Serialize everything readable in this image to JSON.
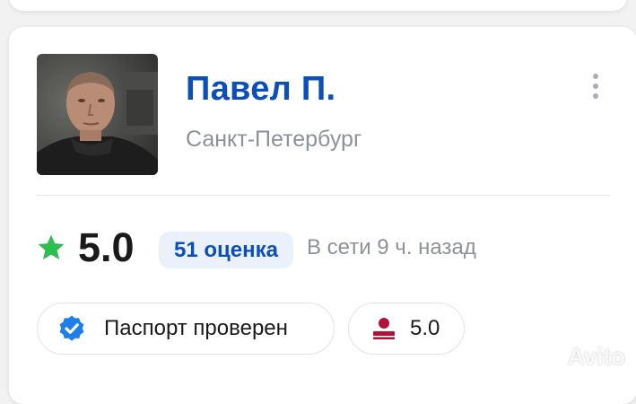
{
  "profile": {
    "name": "Павел П.",
    "city": "Санкт-Петербург"
  },
  "stats": {
    "rating": "5.0",
    "reviews": "51 оценка",
    "online": "В сети 9 ч. назад"
  },
  "badges": {
    "passport": "Паспорт проверен",
    "score": "5.0"
  },
  "watermark": "Avito",
  "colors": {
    "accent": "#0a4fba",
    "star": "#2ebd4f",
    "verified": "#1e7fe8",
    "score_icon": "#b01238"
  },
  "icons": {
    "star": "star-icon",
    "verified": "verified-check-icon",
    "score": "user-score-icon",
    "more": "more-vertical-icon"
  }
}
